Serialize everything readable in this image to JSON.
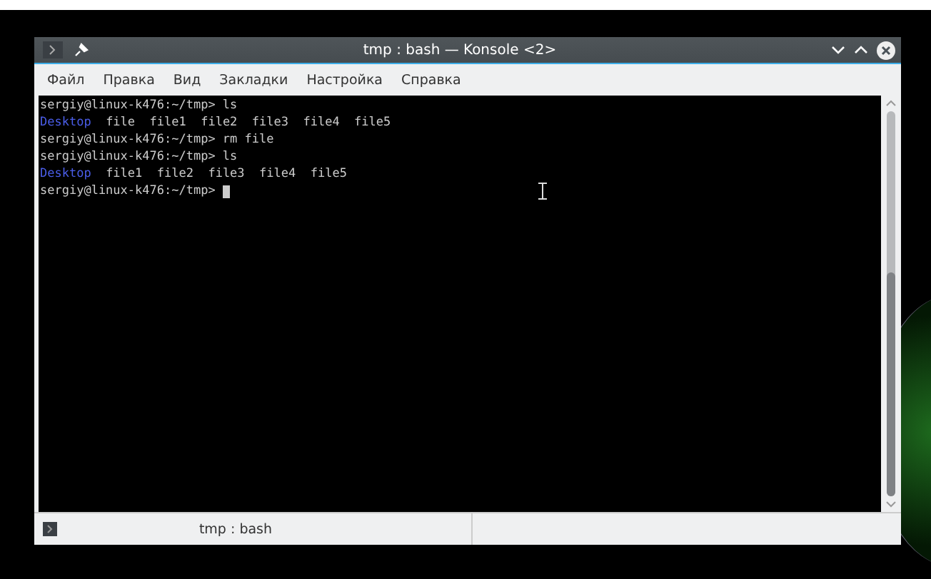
{
  "window": {
    "title": "tmp : bash — Konsole <2>"
  },
  "menu": [
    "Файл",
    "Правка",
    "Вид",
    "Закладки",
    "Настройка",
    "Справка"
  ],
  "terminal": {
    "lines": [
      {
        "segments": [
          {
            "kind": "plain",
            "text": "sergiy@linux-k476:~/tmp> ls"
          }
        ]
      },
      {
        "segments": [
          {
            "kind": "dir",
            "text": "Desktop"
          },
          {
            "kind": "plain",
            "text": "  file  file1  file2  file3  file4  file5"
          }
        ]
      },
      {
        "segments": [
          {
            "kind": "plain",
            "text": "sergiy@linux-k476:~/tmp> rm file"
          }
        ]
      },
      {
        "segments": [
          {
            "kind": "plain",
            "text": "sergiy@linux-k476:~/tmp> ls"
          }
        ]
      },
      {
        "segments": [
          {
            "kind": "dir",
            "text": "Desktop"
          },
          {
            "kind": "plain",
            "text": "  file1  file2  file3  file4  file5"
          }
        ]
      },
      {
        "segments": [
          {
            "kind": "plain",
            "text": "sergiy@linux-k476:~/tmp> "
          }
        ],
        "cursor": true
      }
    ]
  },
  "tabs": [
    {
      "label": "tmp : bash",
      "selected": true
    }
  ]
}
